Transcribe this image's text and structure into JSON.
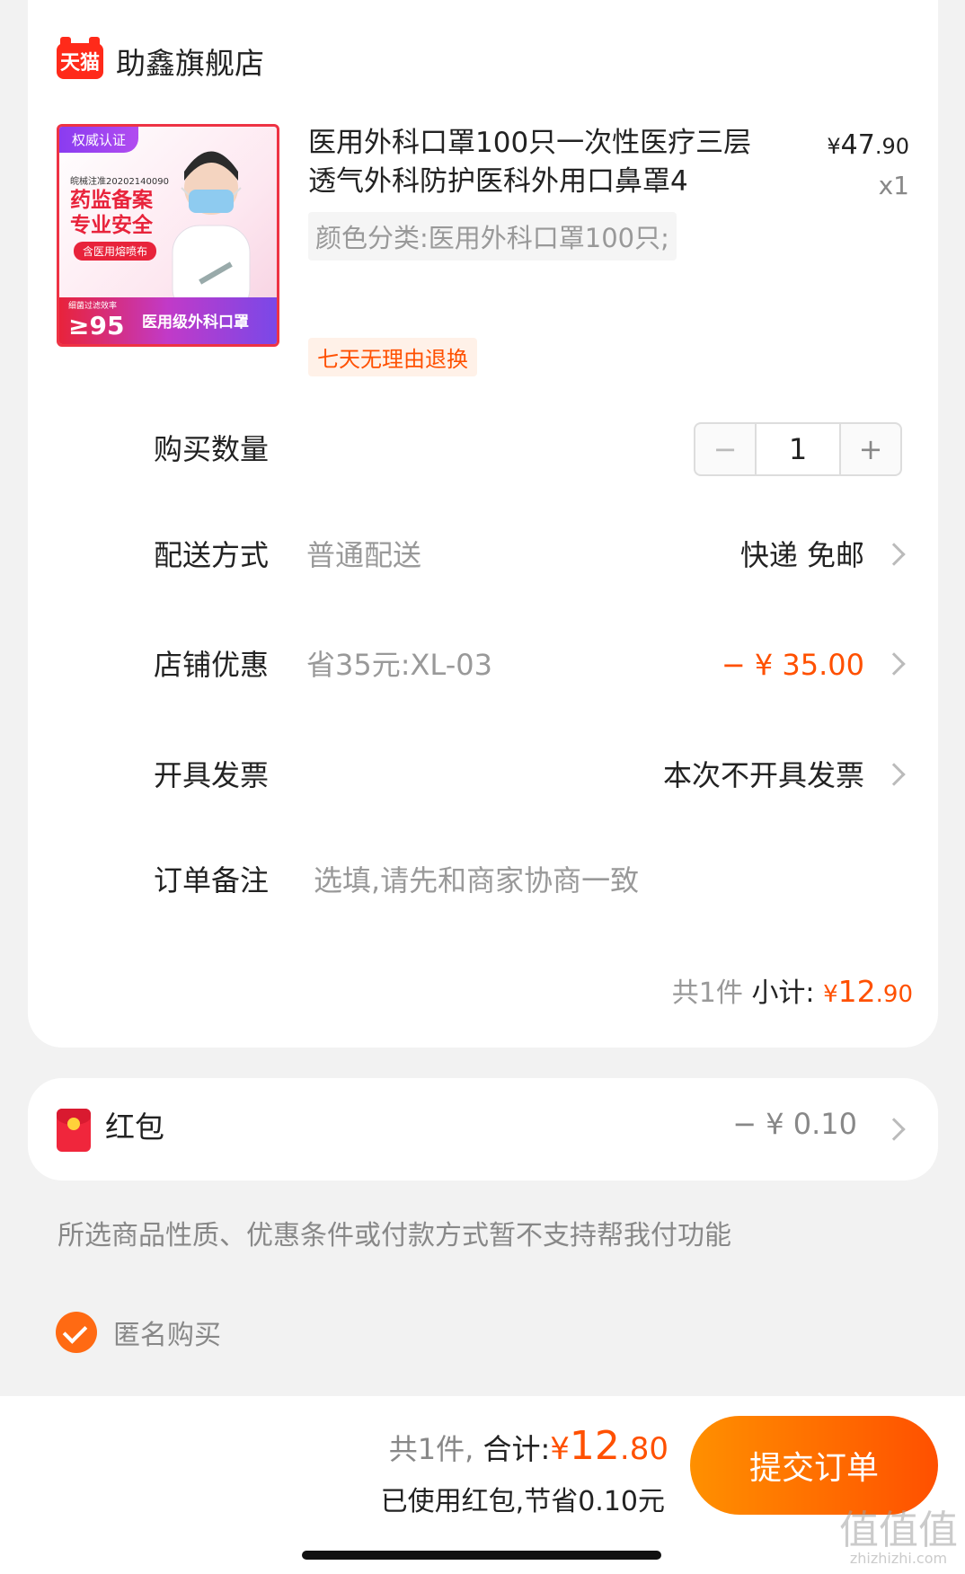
{
  "shop": {
    "logo_text": "天猫",
    "name": "助鑫旗舰店"
  },
  "product": {
    "image": {
      "badge": "权威认证",
      "reg_no": "皖械注准20202140090",
      "headline_1": "药监备案",
      "headline_2": "专业安全",
      "pill": "含医用熔喷布",
      "bottom_small": "细菌过滤效率",
      "bottom_big": "≥95",
      "bottom_text": "医用级外科口罩"
    },
    "title": "医用外科口罩100只一次性医疗三层透气外科防护医科外用口鼻罩4",
    "price_yen": "¥",
    "price_int": "47",
    "price_dec": ".90",
    "quantity_label": "x1",
    "sku": "颜色分类:医用外科口罩100只;",
    "return_tag": "七天无理由退换"
  },
  "rows": {
    "quantity": {
      "label": "购买数量",
      "minus": "−",
      "value": "1",
      "plus": "+"
    },
    "delivery": {
      "label": "配送方式",
      "sub": "普通配送",
      "value": "快递 免邮"
    },
    "discount": {
      "label": "店铺优惠",
      "sub": "省35元:XL-03",
      "value": "− ¥ 35.00"
    },
    "invoice": {
      "label": "开具发票",
      "value": "本次不开具发票"
    },
    "note": {
      "label": "订单备注",
      "placeholder": "选填,请先和商家协商一致"
    }
  },
  "subtotal": {
    "count": "共1件",
    "label": "小计:",
    "yen": "¥",
    "int": "12",
    "dec": ".90"
  },
  "hongbao": {
    "label": "红包",
    "value": "− ¥ 0.10"
  },
  "notice": "所选商品性质、优惠条件或付款方式暂不支持帮我付功能",
  "anonymous": {
    "label": "匿名购买",
    "checked": true
  },
  "footer": {
    "count": "共1件,",
    "total_label": "合计:",
    "yen": "¥",
    "total_int": "12",
    "total_dec": ".80",
    "saved": "已使用红包,节省0.10元",
    "submit": "提交订单"
  },
  "watermark": {
    "text": "值值值",
    "url": "zhizhizhi.com"
  },
  "colors": {
    "accent": "#ff5000",
    "submit_gradient_start": "#ff9000",
    "background": "#f2f2f2"
  }
}
